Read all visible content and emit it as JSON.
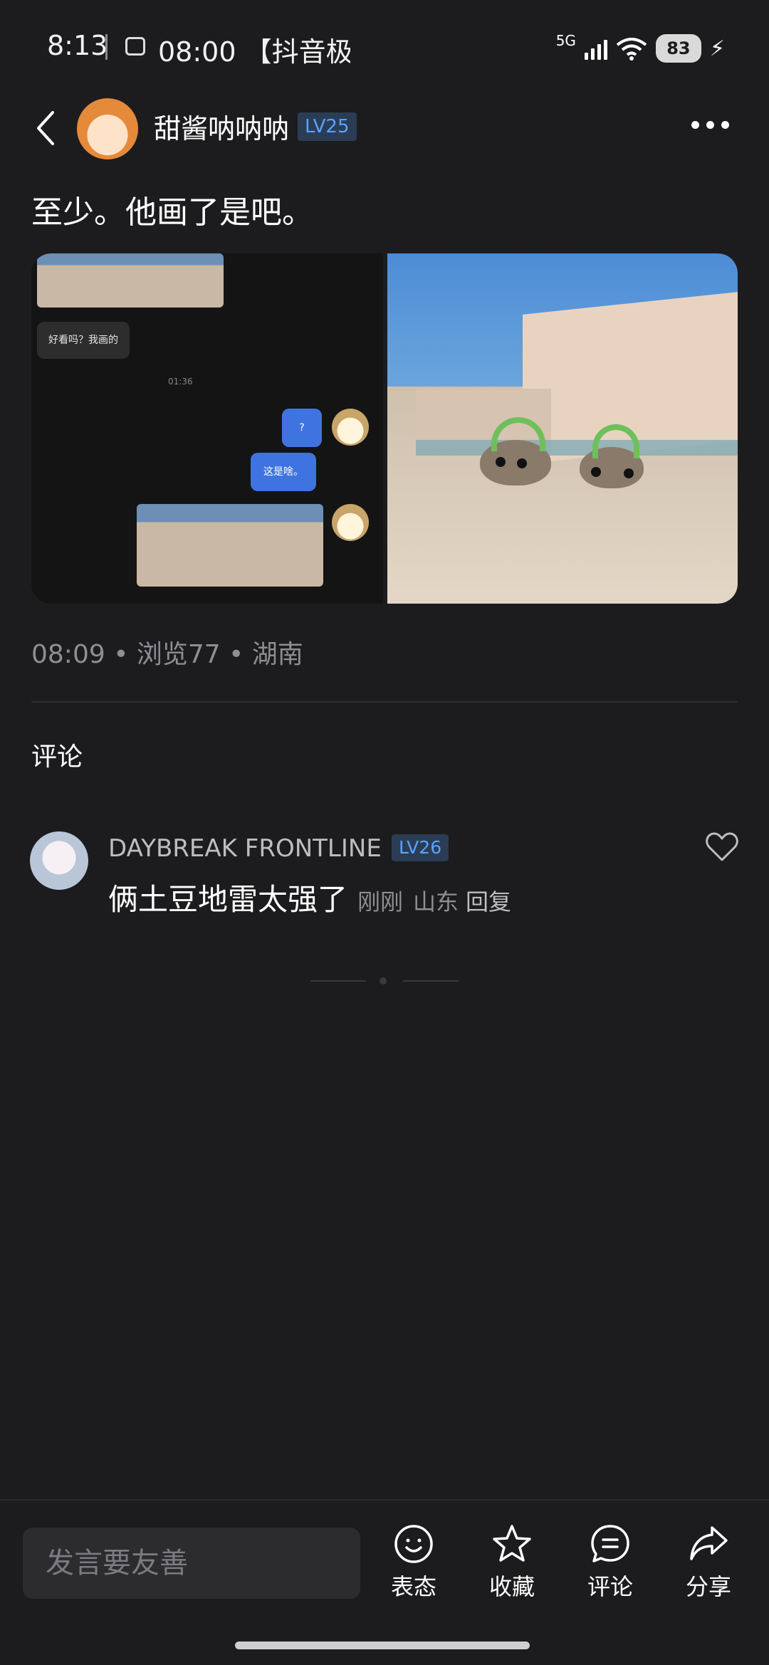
{
  "status_bar": {
    "time": "8:13",
    "notification": "08:00 【抖音极",
    "network": "5G",
    "battery": "83"
  },
  "post": {
    "author": "甜酱呐呐呐",
    "author_level": "LV25",
    "text": "至少。他画了是吧。",
    "meta": "08:09 • 浏览77 • 湖南",
    "images": {
      "left_chat": {
        "bubble_left": "好看吗？我画的",
        "time": "01:36",
        "bubble_q": "?",
        "bubble_reply": "这是啥。"
      }
    }
  },
  "comments": {
    "title": "评论",
    "items": [
      {
        "name": "DAYBREAK FRONTLINE",
        "level": "LV26",
        "text": "俩土豆地雷太强了",
        "time": "刚刚",
        "location": "山东",
        "reply": "回复"
      }
    ]
  },
  "bottom_bar": {
    "input_placeholder": "发言要友善",
    "actions": [
      "表态",
      "收藏",
      "评论",
      "分享"
    ]
  },
  "icons": {
    "back": "chevron-left-icon",
    "more": "more-icon",
    "like": "heart-icon",
    "react": "smiley-icon",
    "favorite": "star-icon",
    "comment": "comment-icon",
    "share": "share-icon"
  }
}
